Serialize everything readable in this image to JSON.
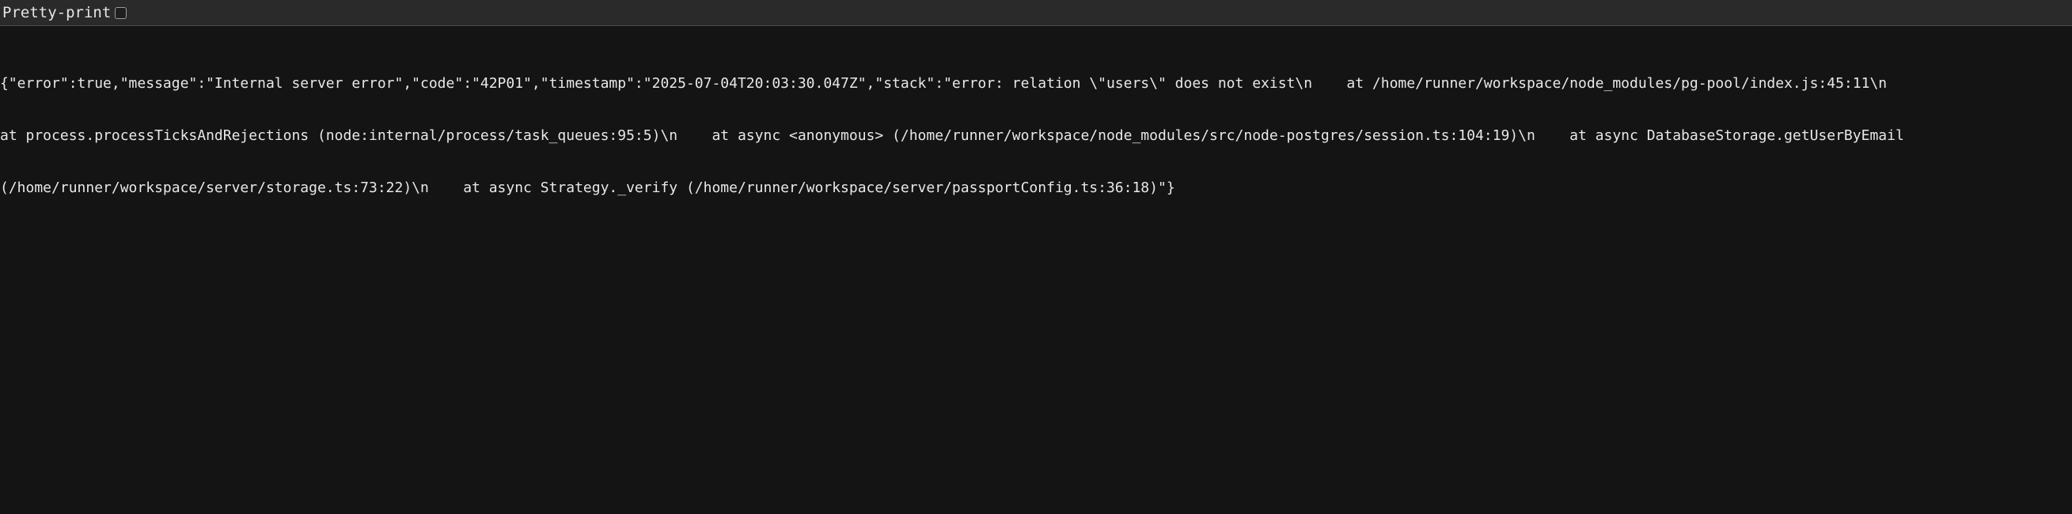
{
  "toolbar": {
    "pretty_print_label": "Pretty-print",
    "pretty_print_checked": false
  },
  "response_body": {
    "lines": [
      "{\"error\":true,\"message\":\"Internal server error\",\"code\":\"42P01\",\"timestamp\":\"2025-07-04T20:03:30.047Z\",\"stack\":\"error: relation \\\"users\\\" does not exist\\n    at /home/runner/workspace/node_modules/pg-pool/index.js:45:11\\n    ",
      "at process.processTicksAndRejections (node:internal/process/task_queues:95:5)\\n    at async <anonymous> (/home/runner/workspace/node_modules/src/node-postgres/session.ts:104:19)\\n    at async DatabaseStorage.getUserByEmail",
      "(/home/runner/workspace/server/storage.ts:73:22)\\n    at async Strategy._verify (/home/runner/workspace/server/passportConfig.ts:36:18)\"}"
    ]
  },
  "colors": {
    "background": "#141414",
    "toolbar_background": "#2a2a2a",
    "text": "#e8e8e8"
  }
}
